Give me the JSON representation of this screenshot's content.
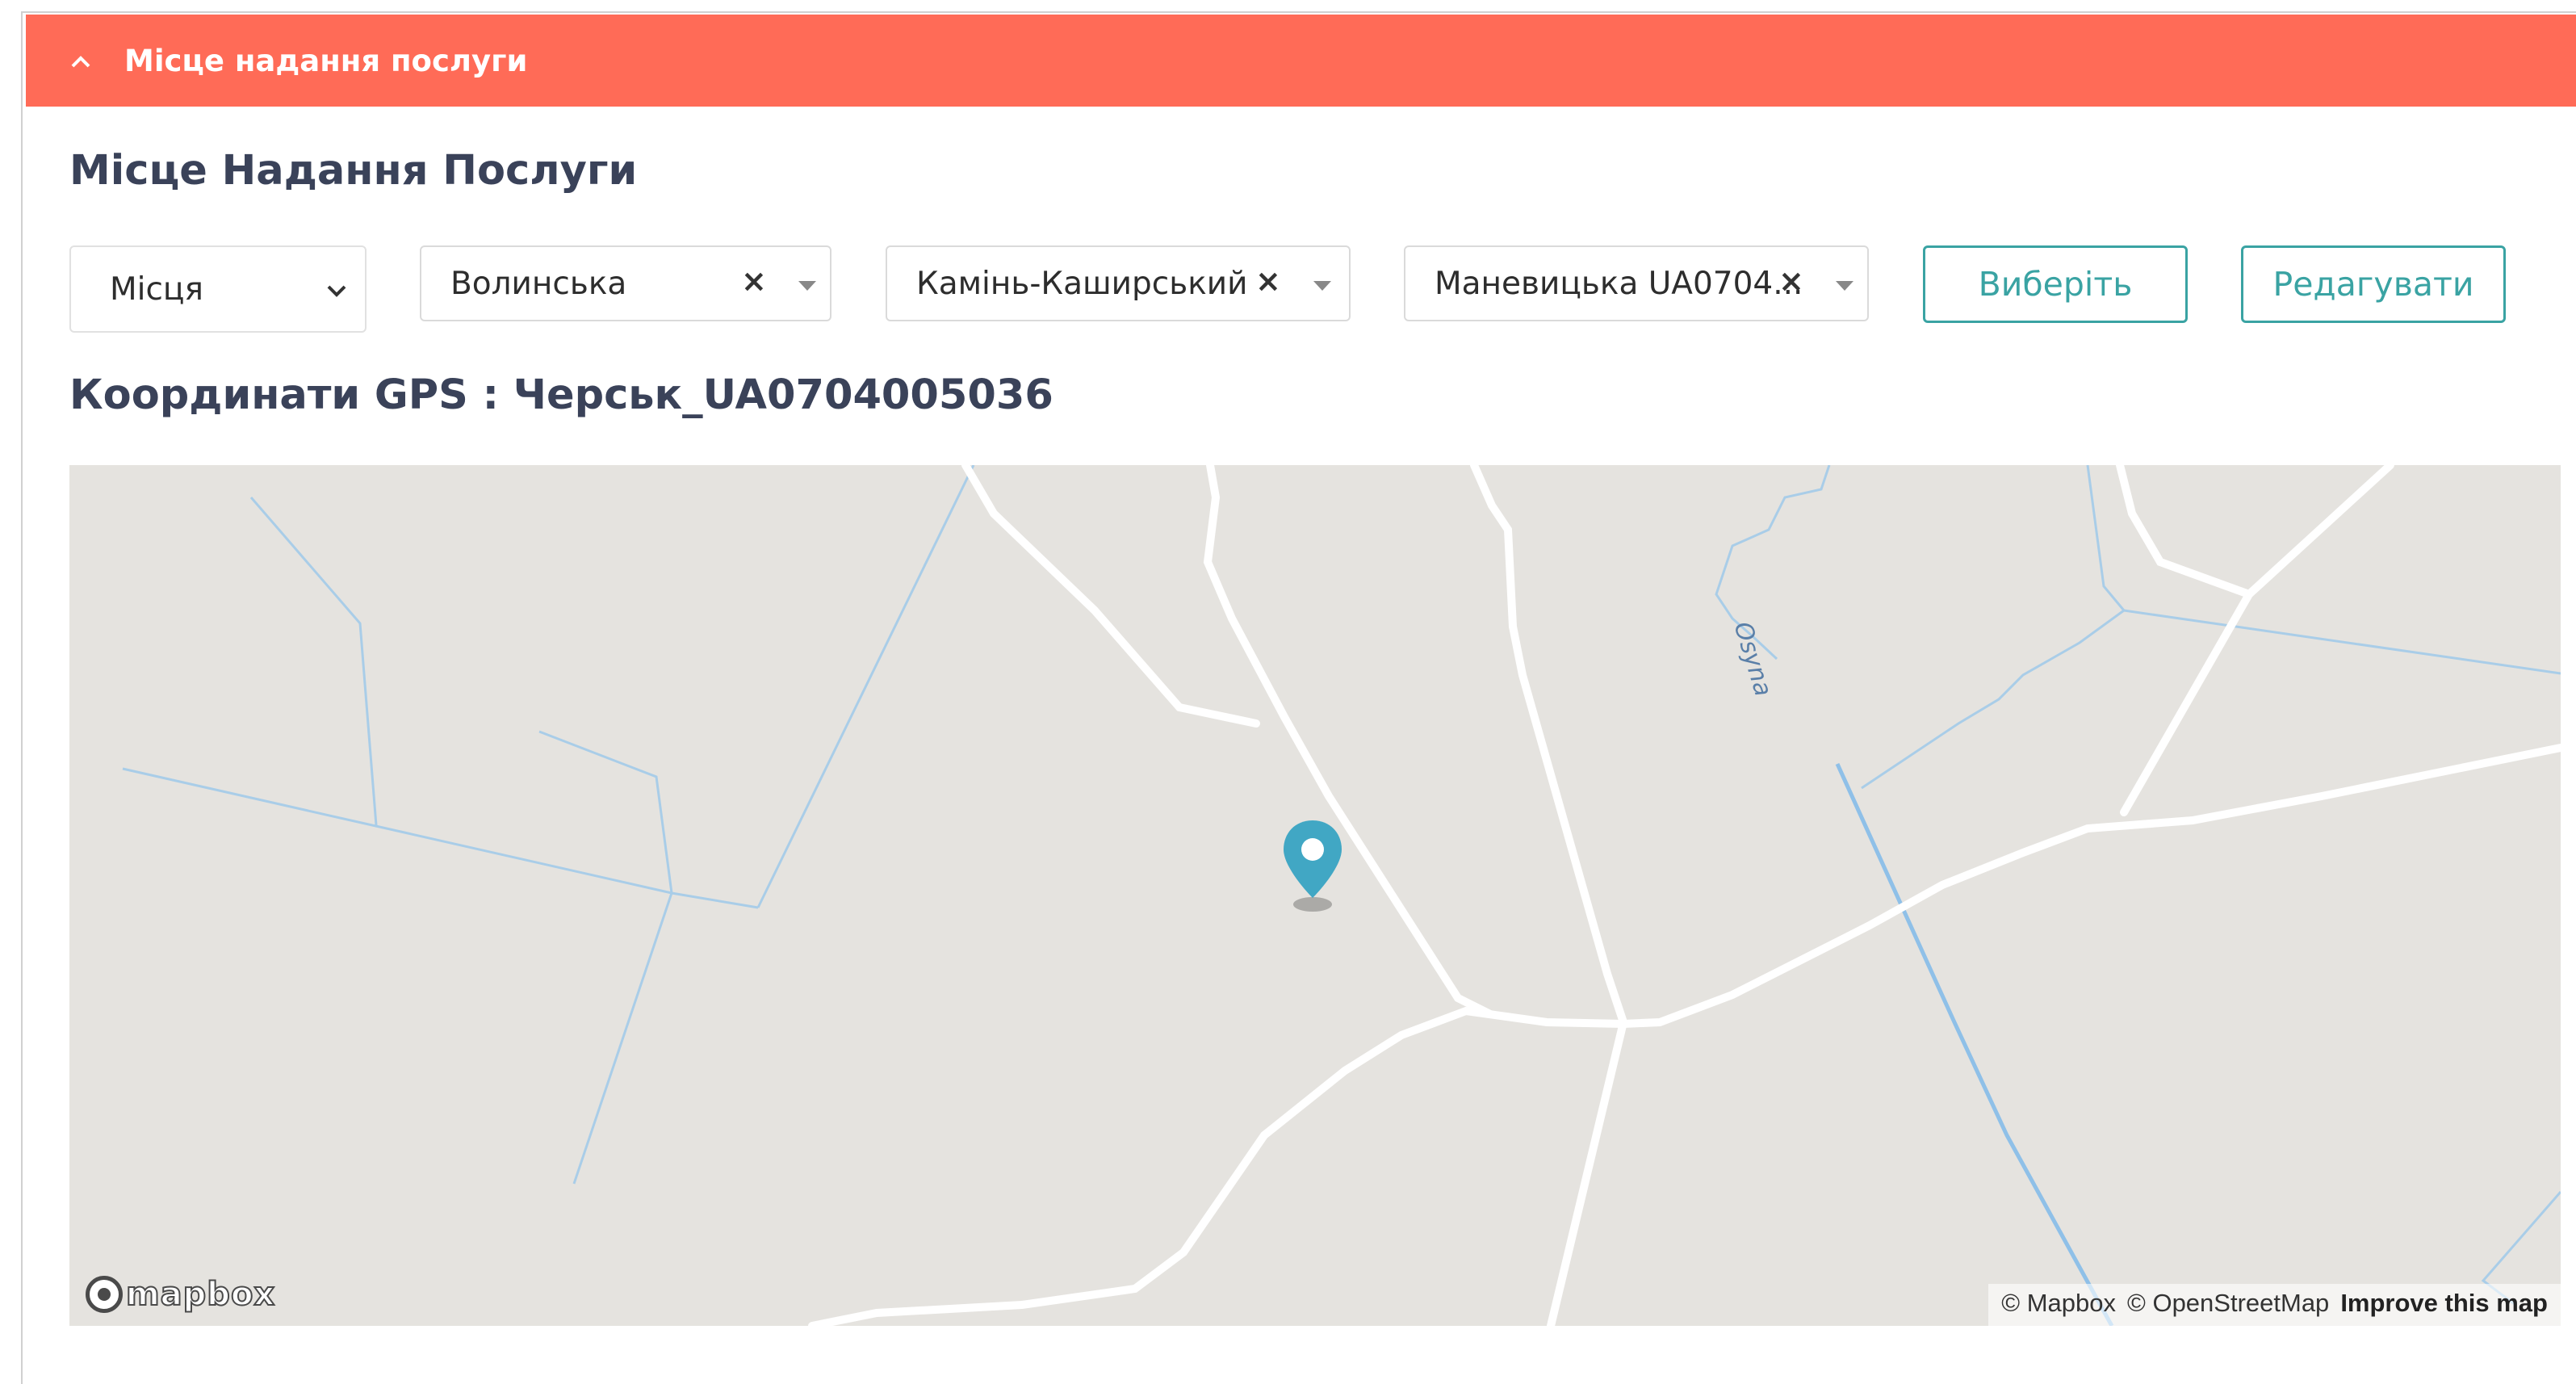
{
  "section": {
    "toggle_icon": "chevron-up-icon",
    "title": "Місце надання послуги",
    "color": "#ff6b57"
  },
  "page_title": "Місце Надання Послуги",
  "filters": {
    "place_type": {
      "value": "Місця",
      "icon": "chevron-down-icon"
    },
    "region": {
      "value": "Волинська",
      "clear": "×"
    },
    "district": {
      "value": "Камінь-Каширський",
      "clear": "×"
    },
    "community": {
      "value": "Маневицька UA0704...",
      "clear": "×"
    }
  },
  "buttons": {
    "select": "Виберіть",
    "edit": "Редагувати",
    "accent": "#3aa3a3"
  },
  "gps": {
    "title": "Координати GPS : Черськ_UA0704005036"
  },
  "map": {
    "river_label": "Osyna",
    "logo_text": "mapbox",
    "attribution": {
      "mapbox": "© Mapbox",
      "osm": "© OpenStreetMap",
      "improve": "Improve this map"
    },
    "marker_icon": "map-pin-icon",
    "marker_color": "#41a7c4"
  }
}
